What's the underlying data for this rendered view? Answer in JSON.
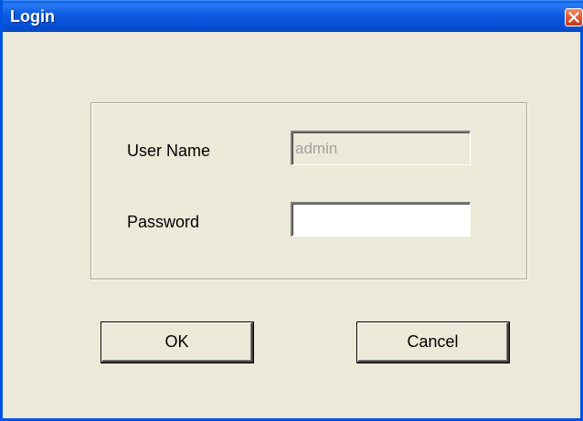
{
  "window": {
    "title": "Login",
    "close_icon": "close-icon"
  },
  "form": {
    "username_label": "User Name",
    "username_value": "admin",
    "password_label": "Password",
    "password_value": ""
  },
  "buttons": {
    "ok_label": "OK",
    "cancel_label": "Cancel"
  },
  "colors": {
    "titlebar": "#0054e3",
    "dialog_bg": "#ece9d8",
    "close_button": "#e35a33"
  }
}
